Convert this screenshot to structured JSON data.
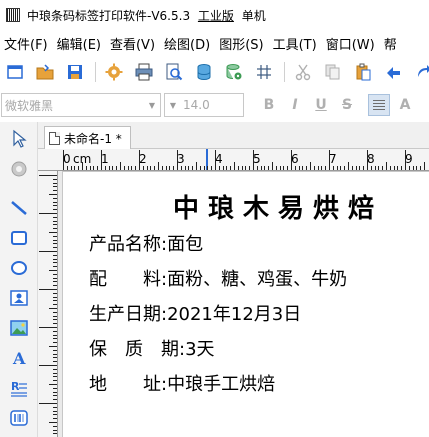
{
  "window": {
    "app_name": "中琅条码标签打印软件-V6.5.3",
    "edition": "工业版",
    "mode": "单机"
  },
  "menu": [
    {
      "label": "文件(F)"
    },
    {
      "label": "编辑(E)"
    },
    {
      "label": "查看(V)"
    },
    {
      "label": "绘图(D)"
    },
    {
      "label": "图形(S)"
    },
    {
      "label": "工具(T)"
    },
    {
      "label": "窗口(W)"
    },
    {
      "label": "帮"
    }
  ],
  "font": {
    "family": "微软雅黑",
    "size": "14.0",
    "bold": "B",
    "italic": "I",
    "underline": "U",
    "strike": "S",
    "partial": "A"
  },
  "document": {
    "tab_title": "未命名-1 *"
  },
  "ruler": {
    "unit": "cm",
    "labels": [
      "0",
      "1",
      "2",
      "3",
      "4",
      "5",
      "6",
      "7",
      "8",
      "9"
    ]
  },
  "label": {
    "title": "中琅木易烘焙",
    "lines": [
      {
        "key": "产品名称:",
        "value": "面包"
      },
      {
        "key": "配　　料:",
        "value": "面粉、糖、鸡蛋、牛奶"
      },
      {
        "key": "生产日期:",
        "value": "2021年12月3日"
      },
      {
        "key": "保　质　期:",
        "value": "3天"
      },
      {
        "key": "地　　址:",
        "value": "中琅手工烘焙"
      }
    ]
  },
  "colors": {
    "accent_blue": "#2a6bd6",
    "toolbar_orange": "#e7a23b",
    "toolbar_green": "#3d9b54"
  }
}
